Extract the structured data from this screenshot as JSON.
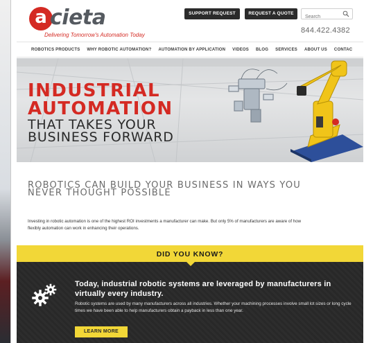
{
  "header": {
    "logo_mark": "a",
    "logo_text": "cieta",
    "tagline": "Delivering Tomorrow's Automation Today",
    "support_button": "SUPPORT REQUEST",
    "quote_button": "REQUEST A QUOTE",
    "search_placeholder": "Search",
    "phone": "844.422.4382"
  },
  "nav": {
    "items": [
      "ROBOTICS PRODUCTS",
      "WHY ROBOTIC AUTOMATION?",
      "AUTOMATION BY APPLICATION",
      "VIDEOS",
      "BLOG",
      "SERVICES",
      "ABOUT US",
      "CONTAC"
    ]
  },
  "hero": {
    "line1": "INDUSTRIAL",
    "line2": "AUTOMATION",
    "line3": "THAT TAKES YOUR",
    "line4": "BUSINESS FORWARD"
  },
  "section2": {
    "heading": "ROBOTICS CAN BUILD YOUR BUSINESS IN WAYS YOU NEVER THOUGHT POSSIBLE",
    "body": "Investing in robotic automation is one of the highest ROI investments a manufacturer can make. But only 5% of manufacturers are aware of how flexibly automation can work in enhancing their operations."
  },
  "did_you_know": {
    "title": "DID YOU KNOW?",
    "headline": "Today, industrial robotic systems are leveraged by manufacturers in virtually every industry.",
    "body": "Robotic systems are used by many manufacturers across all industries. Whether your machining processes involve small lot sizes or long cycle times we have been able to help manufacturers obtain a payback in less than one year.",
    "button": "LEARN MORE"
  },
  "colors": {
    "brand_red": "#d42a23",
    "accent_yellow": "#f2d737",
    "dark_bg": "#2d2d2d"
  },
  "icons": {
    "search": "search-icon",
    "gears": "gears-icon"
  }
}
